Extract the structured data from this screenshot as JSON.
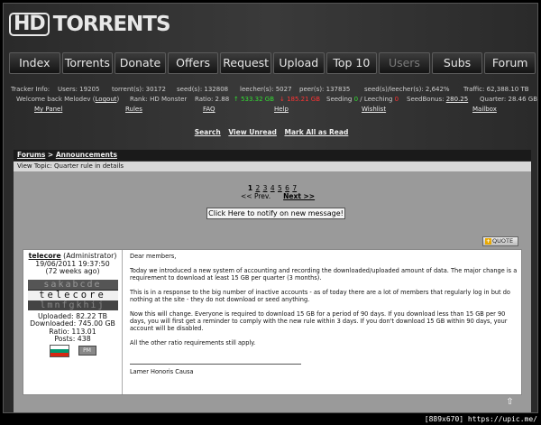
{
  "logo": {
    "hd": "HD",
    "torrents": "TORRENTS"
  },
  "nav": [
    {
      "label": "Index",
      "dim": false
    },
    {
      "label": "Torrents",
      "dim": false
    },
    {
      "label": "Donate",
      "dim": false
    },
    {
      "label": "Offers",
      "dim": false
    },
    {
      "label": "Request",
      "dim": false
    },
    {
      "label": "Upload",
      "dim": false
    },
    {
      "label": "Top 10",
      "dim": false
    },
    {
      "label": "Users",
      "dim": true
    },
    {
      "label": "Subs",
      "dim": false
    },
    {
      "label": "Forum",
      "dim": false
    }
  ],
  "stats": {
    "tracker_info": "Tracker Info:",
    "users": "Users:  19205",
    "torrents": "torrent(s):  30172",
    "seeds": "seed(s):  132808",
    "leechers": "leecher(s):  5027",
    "peers": "peer(s):  137835",
    "ratio": "seed(s)/leecher(s):  2,642%",
    "traffic": "Traffic:  62,388.10 TB"
  },
  "user": {
    "welcome": "Welcome back Melodev (",
    "logout": "Logout",
    "welcome_end": ")",
    "rank": "Rank: HD Monster",
    "ratio": "Ratio: 2.88",
    "up": "↑ 533.32 GB",
    "down": "↓ 185.21 GB",
    "seeding_label": "Seeding",
    "seeding": "0",
    "leeching_label": "/ Leeching",
    "leeching": "0",
    "seedbonus_label": "SeedBonus:",
    "seedbonus": "280.25",
    "quarter": "Quarter: 28.46 GB"
  },
  "links": {
    "mypanel": "My Panel",
    "rules": "Rules",
    "faq": "FAQ",
    "help": "Help",
    "wishlist": "Wishlist",
    "mailbox": "Mailbox"
  },
  "actions": {
    "search": "Search",
    "unread": "View Unread",
    "markread": "Mark All as Read"
  },
  "breadcrumb": {
    "forums": "Forums",
    "sep": " > ",
    "announcements": "Announcements"
  },
  "view_topic": "View Topic: Quarter rule in details",
  "pagination": {
    "pages": [
      "1",
      "2",
      "3",
      "4",
      "5",
      "6",
      "7"
    ],
    "prev": "<< Prev.",
    "next": "Next >>"
  },
  "notify_button": "Click Here to notify on new message!",
  "quote_button": "QUOTE",
  "post": {
    "author": "telecore",
    "role": " (Administrator)",
    "date": "19/06/2011 19:37:50",
    "ago": "(72 weeks ago)",
    "uploaded": "Uploaded: 82.22 TB",
    "downloaded": "Downloaded: 745.00 GB",
    "ratio": "Ratio: 113.01",
    "posts": "Posts: 438",
    "pm": "PM",
    "banner": {
      "row1": "sakabcde",
      "row2": "telecore",
      "row3": "lmnfgkhij"
    },
    "flag_colors": [
      "#ffffff",
      "#00966e",
      "#d62612"
    ],
    "greeting": "Dear members,",
    "p1": "Today we introduced a new system of accounting and recording the downloaded/uploaded amount of data. The major change is a requirement to download at least 15 GB per quarter (3 months).",
    "p2": "This is in a response to the big number of inactive accounts - as of today there are a lot of members that regularly log in but do nothing at the site - they do not download or seed anything.",
    "p3": "Now this will change. Everyone is required to download 15 GB for a period of 90 days. If you download less than 15 GB per 90 days, you will first get a reminder to comply with the new rule within 3 days. If you don't download 15 GB within 90 days, your account will be disabled.",
    "p4": "All the other ratio requirements still apply.",
    "signature": "Lamer Honoris Causa"
  },
  "watermark": "[889x670] https://upic.me/"
}
